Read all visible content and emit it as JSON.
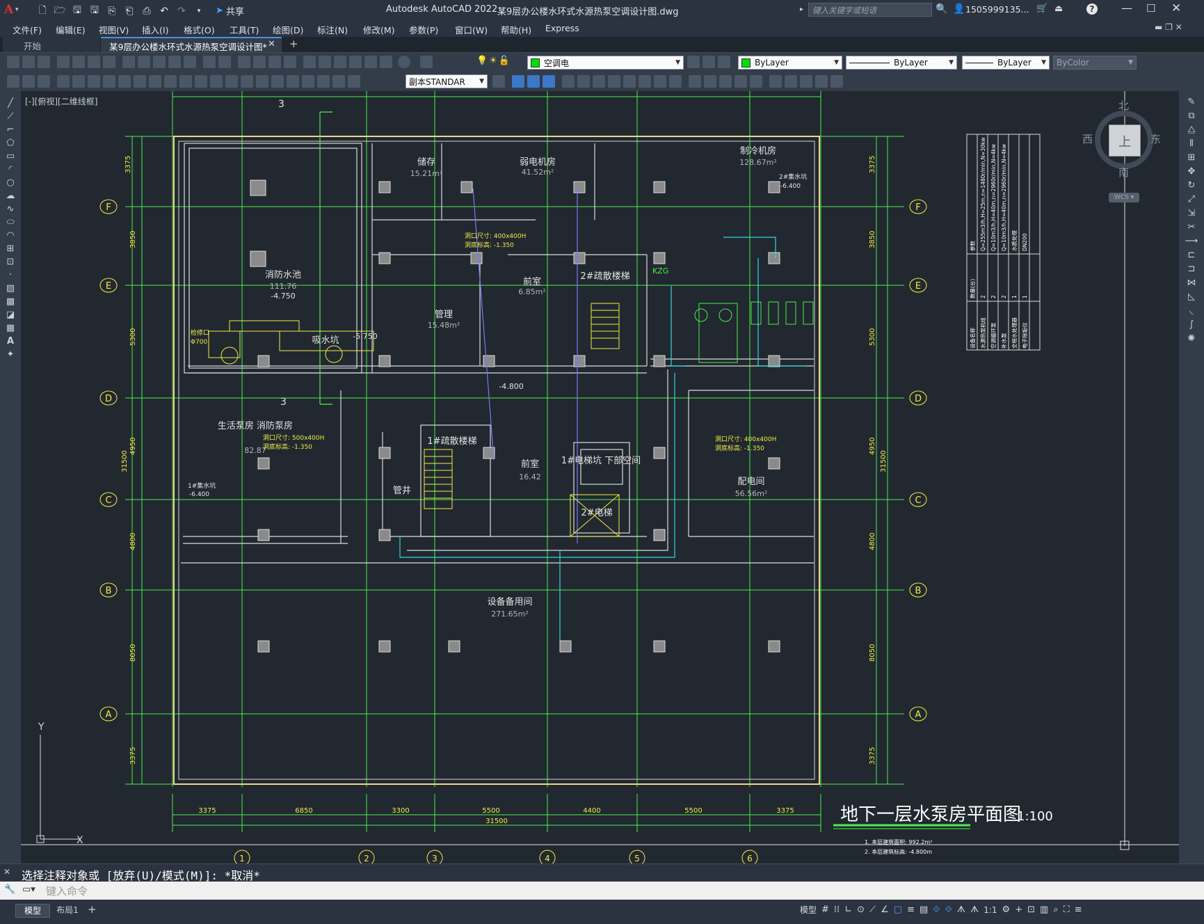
{
  "window": {
    "app_title": "Autodesk AutoCAD 2022",
    "file_title": "某9层办公楼水环式水源热泵空调设计图.dwg",
    "share_label": "共享",
    "search_placeholder": "键入关键字或短语",
    "user": "1505999135...",
    "help": "?"
  },
  "menu": [
    "文件(F)",
    "编辑(E)",
    "视图(V)",
    "插入(I)",
    "格式(O)",
    "工具(T)",
    "绘图(D)",
    "标注(N)",
    "修改(M)",
    "参数(P)",
    "窗口(W)",
    "帮助(H)",
    "Express"
  ],
  "tabs": {
    "start": "开始",
    "active": "某9层办公楼水环式水源热泵空调设计图*",
    "add": "+"
  },
  "properties": {
    "layer": "空调电",
    "color": "ByLayer",
    "linetype": "ByLayer",
    "lineweight": "ByLayer",
    "plotstyle": "ByColor",
    "textstyle": "副本STANDAR"
  },
  "viewport_label": "[-][俯视][二维线框]",
  "viewcube": {
    "north": "北",
    "south": "南",
    "east": "东",
    "west": "西",
    "top": "上",
    "wcs": "WCS"
  },
  "drawing": {
    "title": "地下一层水泵房平面图",
    "scale": "1:100",
    "notes": [
      "1. 本层建筑面积: 992.2m²",
      "2. 本层建筑标高: -4.800m"
    ],
    "grid_cols": [
      "1",
      "2",
      "3",
      "4",
      "5",
      "6"
    ],
    "grid_rows": [
      "F",
      "E",
      "D",
      "C",
      "B",
      "A"
    ],
    "bottom_dims": [
      "3375",
      "6850",
      "3300",
      "5500",
      "4400",
      "5500",
      "3375"
    ],
    "total_dim": "31500",
    "left_dims": [
      "3375",
      "3850",
      "5300",
      "4950",
      "4800",
      "8050",
      "3375"
    ],
    "left_total": "31500",
    "rooms": [
      {
        "name": "储存",
        "area": "15.21m²"
      },
      {
        "name": "弱电机房",
        "area": "41.52m²"
      },
      {
        "name": "制冷机房",
        "area": "128.67m²"
      },
      {
        "name": "消防水池",
        "area": "111.76"
      },
      {
        "name": "管理",
        "area": "15.48m²"
      },
      {
        "name": "前室",
        "area": "6.85m²"
      },
      {
        "name": "2#疏散楼梯",
        "area": ""
      },
      {
        "name": "吸水坑",
        "area": "-5.750"
      },
      {
        "name": "生活泵房 消防泵房",
        "area": "82.87"
      },
      {
        "name": "1#疏散楼梯",
        "area": ""
      },
      {
        "name": "前室",
        "area": "16.42"
      },
      {
        "name": "1#电梯坑 下部空间",
        "area": ""
      },
      {
        "name": "配电间",
        "area": "56.56m²"
      },
      {
        "name": "管井",
        "area": ""
      },
      {
        "name": "2#电梯",
        "area": ""
      },
      {
        "name": "设备备用间",
        "area": "271.65m²"
      }
    ],
    "elev_pool": "-4.750",
    "elev_floor": "-4.800",
    "section_mark": "3",
    "annotations": {
      "vent1_size": "洞口尺寸: 400x400H",
      "vent1_elev": "洞底标高: -1.350",
      "vent2_size": "洞口尺寸: 500x400H",
      "vent2_elev": "洞底标高: -1.350",
      "vent3_size": "洞口尺寸: 400x400H",
      "vent3_elev": "洞底标高: -1.350",
      "pit_label": "1#集水坑",
      "pit_elev": "-6.400",
      "pit2_label": "2#集水坑",
      "pit2_elev": "-6.400",
      "kzg": "KZG",
      "manhole": "检修口",
      "manhole_dia": "Φ700"
    },
    "equipment_table": {
      "header": [
        "设备名称",
        "数量(台)",
        "参数"
      ],
      "rows": [
        [
          "水源热泵机组",
          "2",
          "Q=255m3/h,H=25m,n=1480r/min,N=30kw"
        ],
        [
          "空调循环泵",
          "2",
          "Q=10m3/h,H=40m,n=2960r/min,N=4kw"
        ],
        [
          "补水泵",
          "2",
          "Q=10m3/h,H=40m,n=2960r/min,N=4kw"
        ],
        [
          "全程水处理器",
          "1",
          "水质处理"
        ],
        [
          "电子除垢仪",
          "1",
          "DN200"
        ]
      ]
    }
  },
  "command": {
    "history": "选择注释对象或 [放弃(U)/模式(M)]: *取消*",
    "placeholder": "键入命令"
  },
  "layout_tabs": {
    "model": "模型",
    "layout1": "布局1",
    "add": "+"
  },
  "status": {
    "model": "模型",
    "scale": "1:1"
  },
  "colors": {
    "cad_green": "#4cee4c",
    "cad_yellow": "#f2ec42",
    "cad_cyan": "#30d8e0",
    "cad_blue": "#7a7af2",
    "cad_bg": "#212830"
  }
}
